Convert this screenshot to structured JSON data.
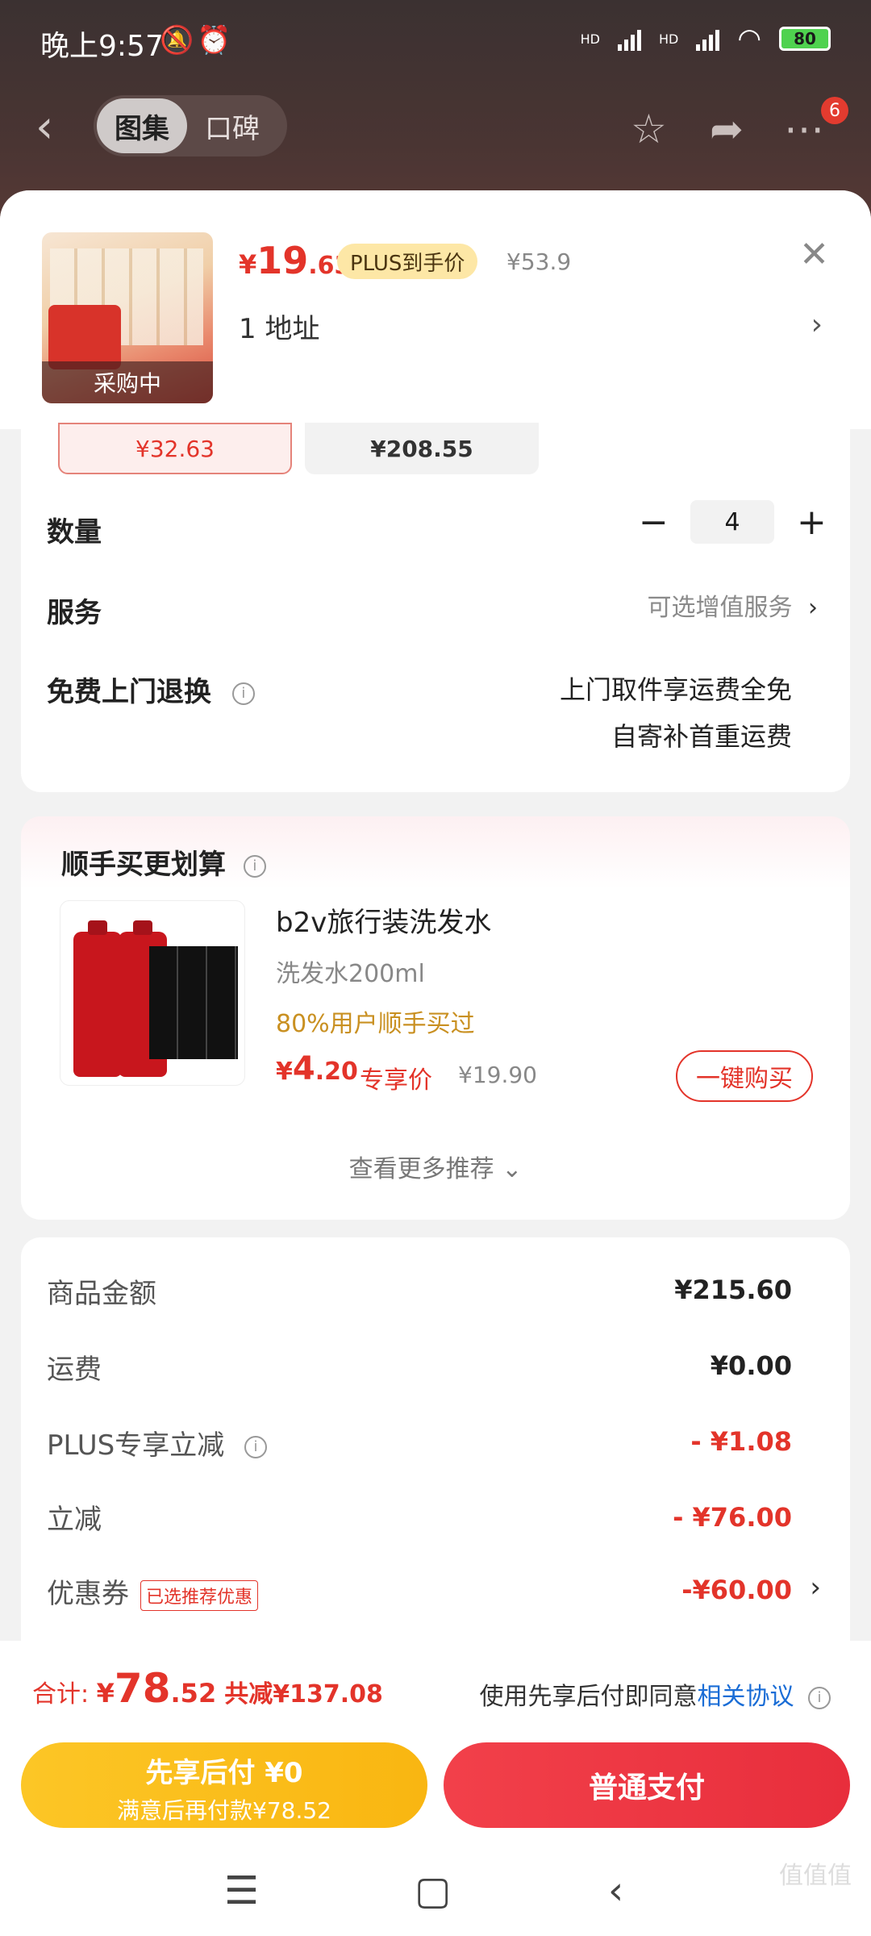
{
  "status_bar": {
    "time": "晚上9:57",
    "battery": "80",
    "hd1": "HD",
    "hd2": "HD",
    "icons": [
      "mute-icon",
      "alarm-icon",
      "signal-icon",
      "wifi-icon",
      "battery-icon"
    ]
  },
  "header": {
    "tabs": [
      {
        "label": "图集",
        "active": true
      },
      {
        "label": "口碑",
        "active": false
      }
    ],
    "badge_count": "6",
    "icons": [
      "back-icon",
      "star-icon",
      "share-icon",
      "more-icon"
    ]
  },
  "product": {
    "image_caption": "采购中",
    "price_symbol": "¥",
    "price_int": "19",
    "price_dec": ".63",
    "plus_label": "PLUS到手价",
    "original_price": "¥53.9",
    "address": "1  地址"
  },
  "specs": [
    {
      "price": "¥32.63",
      "selected": true
    },
    {
      "price": "¥208.55",
      "selected": false
    }
  ],
  "quantity": {
    "label": "数量",
    "value": "4",
    "minus": "−",
    "plus": "+"
  },
  "service": {
    "label": "服务",
    "value": "可选增值服务"
  },
  "returns": {
    "label": "免费上门退换",
    "line1": "上门取件享运费全免",
    "line2": "自寄补首重运费"
  },
  "recommend": {
    "title": "顺手买更划算",
    "name": "b2v旅行装洗发水",
    "spec": "洗发水200ml",
    "hint": "80%用户顺手买过",
    "price_symbol": "¥",
    "price_int": "4",
    "price_dec": ".20",
    "price_tag": "专享价",
    "original_price": "¥19.90",
    "buy_label": "一键购买",
    "more_label": "查看更多推荐 ⌄"
  },
  "summary": {
    "rows": [
      {
        "label": "商品金额",
        "value": "¥215.60"
      },
      {
        "label": "运费",
        "value": "¥0.00"
      },
      {
        "label": "PLUS专享立减",
        "value": "- ¥1.08"
      },
      {
        "label": "立减",
        "value": "- ¥76.00"
      },
      {
        "label": "优惠券",
        "value": "-¥60.00",
        "tag": "已选推荐优惠"
      }
    ]
  },
  "bottom": {
    "total_label": "合计: ",
    "total_symbol": "¥",
    "total_int": "78",
    "total_dec": ".52",
    "save_text": "共减¥137.08",
    "agree_text": "使用先享后付即同意",
    "agree_link": "相关协议",
    "pay_later_title": "先享后付 ¥0",
    "pay_later_sub": "满意后再付款¥78.52",
    "pay_normal": "普通支付"
  },
  "watermark": "值值值",
  "colors": {
    "accent_red": "#e3342a",
    "plus_gold": "#fde7a6",
    "pay_later": "#f9b611",
    "link_blue": "#1a6dd6"
  }
}
